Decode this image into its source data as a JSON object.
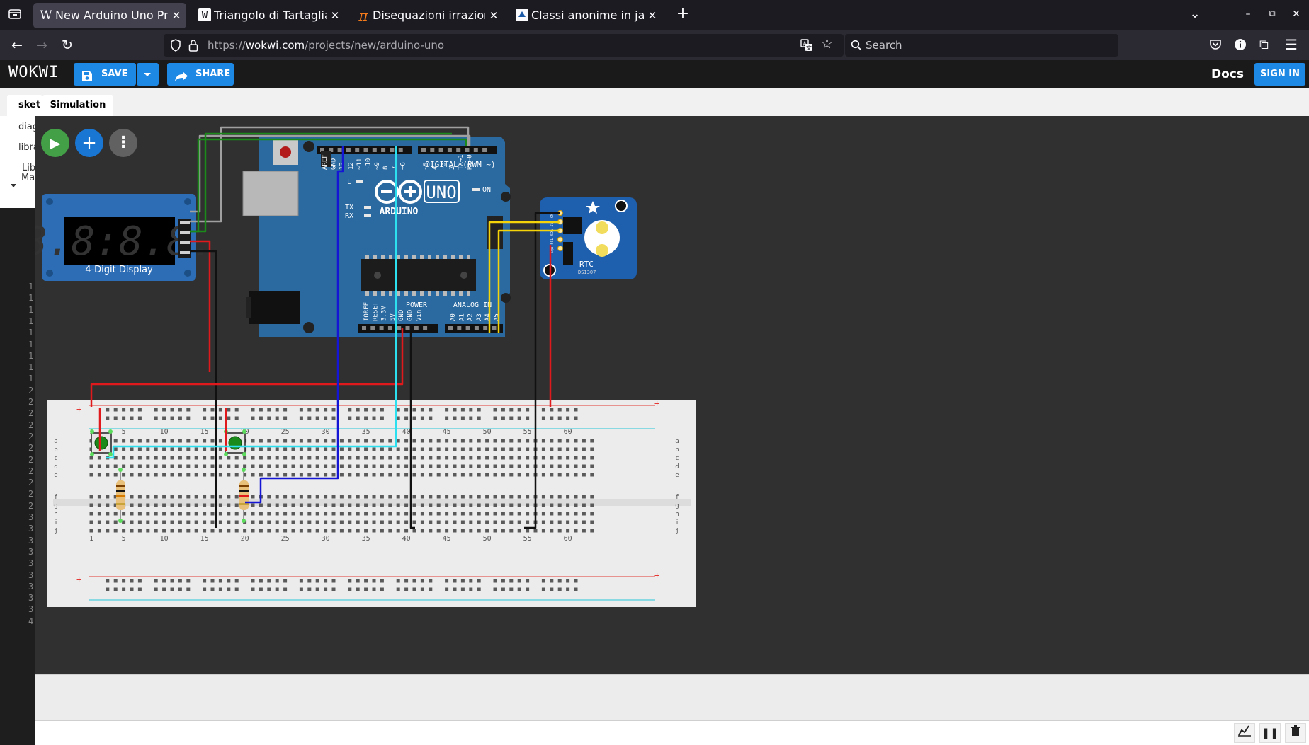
{
  "browser": {
    "tabs": [
      {
        "label": "New Arduino Uno Project",
        "favicon": "W",
        "active": true
      },
      {
        "label": "Triangolo di Tartaglia - W",
        "favicon": "W",
        "active": false
      },
      {
        "label": "Disequazioni irrazionali",
        "favicon": "π",
        "active": false
      },
      {
        "label": "Classi anonime in java - Ja",
        "favicon": "✦",
        "active": false
      }
    ],
    "url_prefix": "https://",
    "url_host": "wokwi.com",
    "url_path": "/projects/new/arduino-uno",
    "search_placeholder": "Search"
  },
  "header": {
    "logo": "WOKWI",
    "save_label": "SAVE",
    "share_label": "SHARE",
    "docs_label": "Docs",
    "signin_label": "SIGN IN"
  },
  "editor": {
    "tabs": [
      {
        "label": "sket",
        "active": false
      },
      {
        "label": "Simulation",
        "active": true
      }
    ],
    "files": [
      "diag",
      "libra",
      "Lib",
      "Man"
    ],
    "line_numbers": [
      "1",
      "1",
      "1",
      "1",
      "1",
      "1",
      "1",
      "1",
      "1",
      "2",
      "2",
      "2",
      "2",
      "2",
      "2",
      "2",
      "2",
      "2",
      "2",
      "2",
      "3",
      "3",
      "3",
      "3",
      "3",
      "3",
      "3",
      "3",
      "3",
      "4"
    ]
  },
  "simulation": {
    "display_label": "4-Digit Display",
    "arduino": {
      "brand": "ARDUINO",
      "model": "UNO",
      "digital_label": "DIGITAL (PWM ~)",
      "power_label": "POWER",
      "analog_label": "ANALOG IN",
      "on_label": "ON",
      "l_label": "L",
      "tx_label": "TX",
      "rx_label": "RX",
      "top_pins": [
        "AREF",
        "GND",
        "13",
        "12",
        "~11",
        "~10",
        "~9",
        "8",
        "7",
        "~6",
        "~5",
        "4",
        "~3",
        "2",
        "TX→1",
        "RX←0"
      ],
      "power_pins": [
        "IOREF",
        "RESET",
        "3.3V",
        "5V",
        "GND",
        "GND",
        "Vin"
      ],
      "analog_pins": [
        "A0",
        "A1",
        "A2",
        "A3",
        "A4",
        "A5"
      ]
    },
    "rtc": {
      "label": "RTC",
      "chip": "DS1307",
      "pins": [
        "GND",
        "5V",
        "SDA",
        "SCL",
        "SQW"
      ]
    },
    "breadboard": {
      "column_numbers": [
        "1",
        "5",
        "10",
        "15",
        "20",
        "25",
        "30",
        "35",
        "40",
        "45",
        "50",
        "55",
        "60"
      ],
      "row_letters_top": [
        "a",
        "b",
        "c",
        "d",
        "e"
      ],
      "row_letters_bottom": [
        "f",
        "g",
        "h",
        "i",
        "j"
      ]
    },
    "controls": {
      "play": "▶",
      "add": "+",
      "menu": "⋮"
    }
  },
  "colors": {
    "accent_blue": "#1e88e5",
    "play_green": "#43a047",
    "arduino_blue": "#2c6b9e",
    "wire_red": "#e0191c",
    "wire_black": "#111111",
    "wire_blue": "#1515d6",
    "wire_cyan": "#2ce0f0",
    "wire_green": "#1b8a1b",
    "wire_gray": "#a0a0a0",
    "wire_yellow": "#f5d40a"
  }
}
